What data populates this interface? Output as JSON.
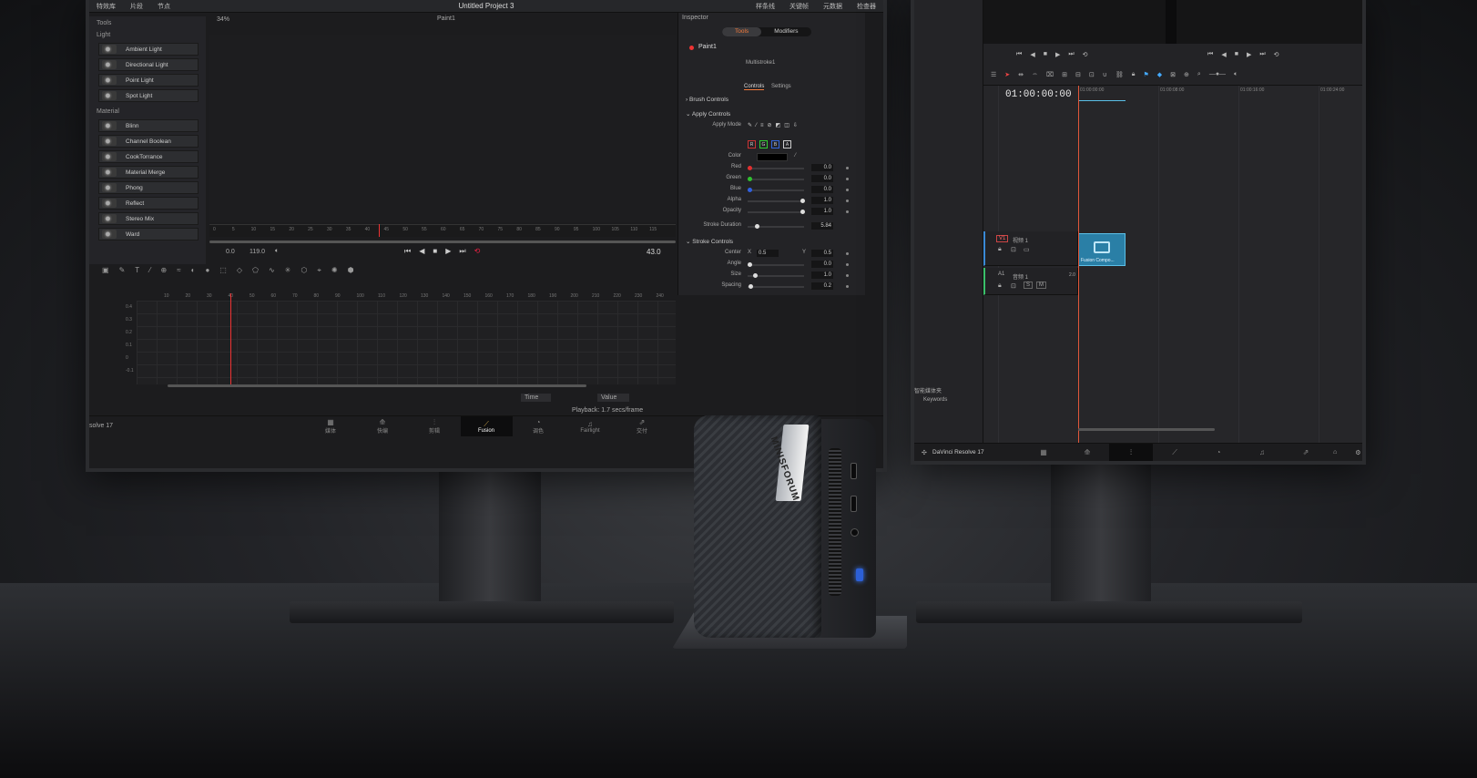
{
  "left_app": {
    "topbar": {
      "items": [
        "特效库",
        "片段",
        "节点"
      ],
      "title": "Untitled Project 3",
      "right_items": [
        "样条线",
        "关键帧",
        "元数据",
        "检查器"
      ]
    },
    "viewer_label": "Paint1",
    "zoom": "34%",
    "tools": {
      "header": "Tools",
      "sections": [
        {
          "name": "Light",
          "items": [
            "Ambient Light",
            "Directional Light",
            "Point Light",
            "Spot Light"
          ]
        },
        {
          "name": "Material",
          "items": [
            "Blinn",
            "Channel Boolean",
            "CookTorrance",
            "Material Merge",
            "Phong",
            "Reflect",
            "Stereo Mix",
            "Ward"
          ]
        }
      ]
    },
    "ruler_ticks": [
      "0",
      "5",
      "10",
      "15",
      "20",
      "25",
      "30",
      "35",
      "40",
      "45",
      "50",
      "55",
      "60",
      "65",
      "70",
      "75",
      "80",
      "85",
      "90",
      "95",
      "100",
      "105",
      "110",
      "115"
    ],
    "transport": {
      "start": "0.0",
      "end": "119.0",
      "current": "43.0"
    },
    "graph_y_ticks": [
      "0.4",
      "0.3",
      "0.2",
      "0.1",
      "0",
      "-0.1"
    ],
    "graph_x_ticks": [
      "10",
      "20",
      "30",
      "40",
      "50",
      "60",
      "70",
      "80",
      "90",
      "100",
      "110",
      "120",
      "130",
      "140",
      "150",
      "160",
      "170",
      "180",
      "190",
      "200",
      "210",
      "220",
      "230",
      "240"
    ],
    "graph_footer": {
      "time_label": "Time",
      "value_label": "Value"
    },
    "status": "Playback: 1.7 secs/frame",
    "app_name_fragment": "solve 17",
    "pages": [
      {
        "icon": "▦",
        "label": "媒体"
      },
      {
        "icon": "⟰",
        "label": "快编"
      },
      {
        "icon": "⫶",
        "label": "剪辑"
      },
      {
        "icon": "⟋",
        "label": "Fusion",
        "active": true
      },
      {
        "icon": "◔",
        "label": "调色"
      },
      {
        "icon": "♫",
        "label": "Fairlight"
      },
      {
        "icon": "⇗",
        "label": "交付"
      }
    ]
  },
  "inspector": {
    "title": "Inspector",
    "tabs": [
      "Tools",
      "Modifiers"
    ],
    "node_name": "Paint1",
    "subtitle": "Multistroke1",
    "subtabs": [
      "Controls",
      "Settings"
    ],
    "sections": {
      "brush": "Brush Controls",
      "apply": "Apply Controls",
      "stroke": "Stroke Controls"
    },
    "apply_mode_label": "Apply Mode",
    "channels": [
      "R",
      "G",
      "B",
      "A"
    ],
    "color_label": "Color",
    "rows": [
      {
        "label": "Red",
        "value": "0.0",
        "pos": 0.0,
        "color": "#e03030"
      },
      {
        "label": "Green",
        "value": "0.0",
        "pos": 0.0,
        "color": "#30c030"
      },
      {
        "label": "Blue",
        "value": "0.0",
        "pos": 0.0,
        "color": "#3060e0"
      },
      {
        "label": "Alpha",
        "value": "1.0",
        "pos": 1.0,
        "color": "#dddddd"
      },
      {
        "label": "Opacity",
        "value": "1.0",
        "pos": 1.0,
        "color": "#dddddd"
      }
    ],
    "stroke_duration": {
      "label": "Stroke Duration",
      "value": "5.84"
    },
    "center": {
      "label": "Center",
      "x_label": "X",
      "x": "0.5",
      "y_label": "Y",
      "y": "0.5"
    },
    "stroke_rows": [
      {
        "label": "Angle",
        "value": "0.0"
      },
      {
        "label": "Size",
        "value": "1.0"
      },
      {
        "label": "Spacing",
        "value": "0.2"
      }
    ]
  },
  "right_app": {
    "timecode": "01:00:00:00",
    "ruler": [
      "01:00:00:00",
      "01:00:08:00",
      "01:00:16:00",
      "01:00:24:00"
    ],
    "video_track": {
      "id": "V1",
      "name": "视频 1"
    },
    "audio_track": {
      "id": "A1",
      "name": "音频 1",
      "channels": "2.0"
    },
    "clip_label": "Fusion Compo...",
    "bin_label": "智能媒体夹",
    "keywords": "Keywords",
    "app_name": "DaVinci Resolve 17",
    "pages": [
      "▦",
      "⟰",
      "⫶",
      "⟋",
      "◔",
      "♫",
      "⇗"
    ]
  },
  "device": {
    "brand": "MINISFORUM",
    "accent": "#2c5fd6"
  },
  "colors": {
    "fusion_accent": "#f47a3a",
    "playhead": "#e33333",
    "clip": "#2a7fa6"
  }
}
